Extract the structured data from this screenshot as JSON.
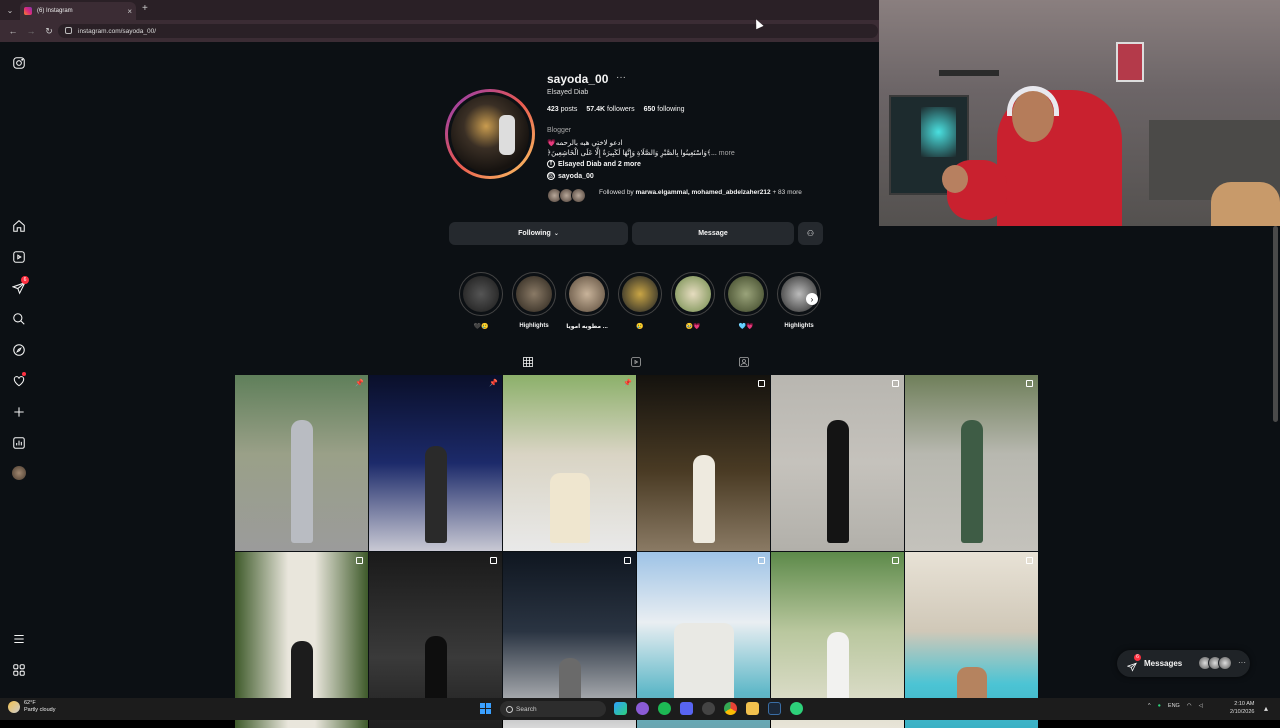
{
  "browser": {
    "tab_title": "(6) Instagram",
    "tab_close": "×",
    "new_tab": "+",
    "url": "instagram.com/sayoda_00/"
  },
  "profile": {
    "username": "sayoda_00",
    "more_options": "···",
    "full_name": "Elsayed Diab",
    "posts_count": "423",
    "posts_label": "posts",
    "followers_count": "57.4K",
    "followers_label": "followers",
    "following_count": "650",
    "following_label": "following",
    "category": "Blogger",
    "bio_line1": "💗ادعو لاختي هبه بالرحمه",
    "bio_line2": "﴿وَاسْتَعِينُوا بِالصَّبْرِ وَالصَّلَاةِ وَإِنَّهَا لَكَبِيرَةٌ إِلَّا عَلَى الْخَاشِعِينَ﴾...",
    "bio_more": "more",
    "facebook_link": "Elsayed Diab and 2 more",
    "threads_handle": "sayoda_00",
    "followed_by_prefix": "Followed by",
    "followed_by_names": "marwa.elgammal, mohamed_abdelzaher212",
    "followed_by_suffix": "+ 83 more"
  },
  "actions": {
    "following_label": "Following",
    "message_label": "Message"
  },
  "highlights": [
    {
      "label": "🖤🥲"
    },
    {
      "label": "Highlights"
    },
    {
      "label": "مطوبه امويا ..."
    },
    {
      "label": "🥲"
    },
    {
      "label": "🥹💗"
    },
    {
      "label": "🩵💗"
    },
    {
      "label": "Highlights"
    }
  ],
  "messages_widget": {
    "label": "Messages",
    "badge": "6",
    "more": "···"
  },
  "sidebar": {
    "notifications_badge": "6"
  },
  "taskbar": {
    "temperature": "62°F",
    "weather": "Partly cloudy",
    "search_placeholder": "Search",
    "language": "ENG",
    "time": "2:10 AM",
    "date": "2/10/2026"
  },
  "colors": {
    "background": "#0c1014",
    "button": "#25292e",
    "accent_badge": "#ff3040",
    "story_ring": "#dd2a7b"
  },
  "icons": {
    "sidebar": [
      "instagram-logo-icon",
      "home-icon",
      "reels-icon",
      "direct-messages-icon",
      "search-icon",
      "explore-icon",
      "notifications-heart-icon",
      "create-plus-icon",
      "dashboard-icon",
      "profile-avatar",
      "menu-icon",
      "threads-apps-icon"
    ],
    "profile_tabs": [
      "grid-icon",
      "reels-icon",
      "tagged-icon"
    ]
  }
}
